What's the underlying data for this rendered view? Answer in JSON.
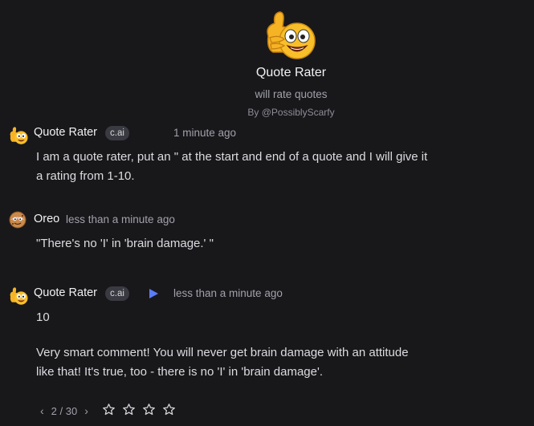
{
  "header": {
    "title": "Quote Rater",
    "description": "will rate quotes",
    "author": "By @PossiblyScarfy"
  },
  "messages": [
    {
      "name": "Quote Rater",
      "badge": "c.ai",
      "time": "1 minute ago",
      "lines": [
        "I am a quote rater, put an \" at the start and end of a quote and I will give it",
        "a rating from 1-10."
      ]
    },
    {
      "name": "Oreo",
      "time": "less than a minute ago",
      "lines": [
        "\"There's no 'I' in 'brain damage.' \""
      ]
    },
    {
      "name": "Quote Rater",
      "badge": "c.ai",
      "time": "less than a minute ago",
      "rating": "10",
      "lines": [
        "Very smart comment! You will never get brain damage with an attitude",
        "like that! It's true, too - there is no 'I' in 'brain damage'."
      ]
    }
  ],
  "footer": {
    "prev": "‹",
    "page": "2 / 30",
    "next": "›",
    "rating_stars": 4,
    "rating_value": 0
  },
  "colors": {
    "background": "#18181b",
    "accent": "#5b7cfa",
    "badge_bg": "#3a3a42"
  },
  "icons": {
    "bot_avatar": "thumbs-up-emoji",
    "user_avatar": "cookie-face",
    "play": "play-icon",
    "star": "star-outline-icon"
  }
}
